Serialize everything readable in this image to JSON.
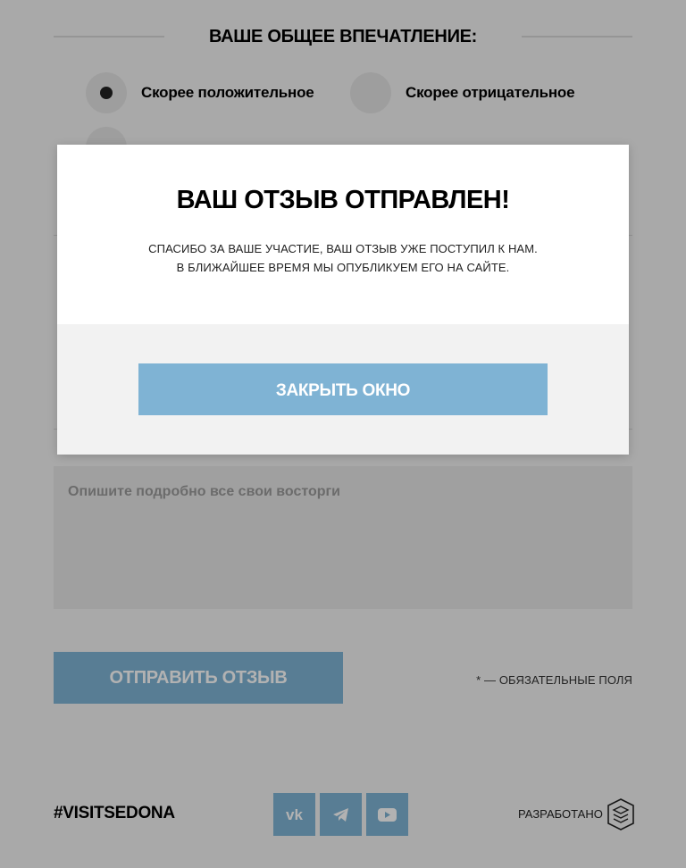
{
  "impression": {
    "title": "ВАШЕ ОБЩЕЕ ВПЕЧАТЛЕНИЕ:",
    "options": [
      {
        "label": "Скорее положительное",
        "selected": true
      },
      {
        "label": "Скорее отрицательное",
        "selected": false
      },
      {
        "label": "",
        "selected": false
      }
    ]
  },
  "review": {
    "placeholder": "Опишите подробно все свои восторги"
  },
  "form": {
    "submit_label": "ОТПРАВИТЬ ОТЗЫВ",
    "required_note": "* — ОБЯЗАТЕЛЬНЫЕ ПОЛЯ"
  },
  "footer": {
    "hashtag": "#VISITSEDONA",
    "socials": [
      "vk-icon",
      "telegram-icon",
      "youtube-icon"
    ],
    "developed_by": "РАЗРАБОТАНО"
  },
  "modal": {
    "title": "ВАШ ОТЗЫВ ОТПРАВЛЕН!",
    "line1": "СПАСИБО ЗА ВАШЕ УЧАСТИЕ, ВАШ ОТЗЫВ УЖЕ ПОСТУПИЛ К НАМ.",
    "line2": "В БЛИЖАЙШЕЕ ВРЕМЯ МЫ ОПУБЛИКУЕМ ЕГО НА САЙТЕ.",
    "close_label": "ЗАКРЫТЬ ОКНО"
  },
  "colors": {
    "accent": "#7fb3d4",
    "background": "#f2f2f2",
    "overlay": "rgba(0,0,0,0.3)"
  }
}
